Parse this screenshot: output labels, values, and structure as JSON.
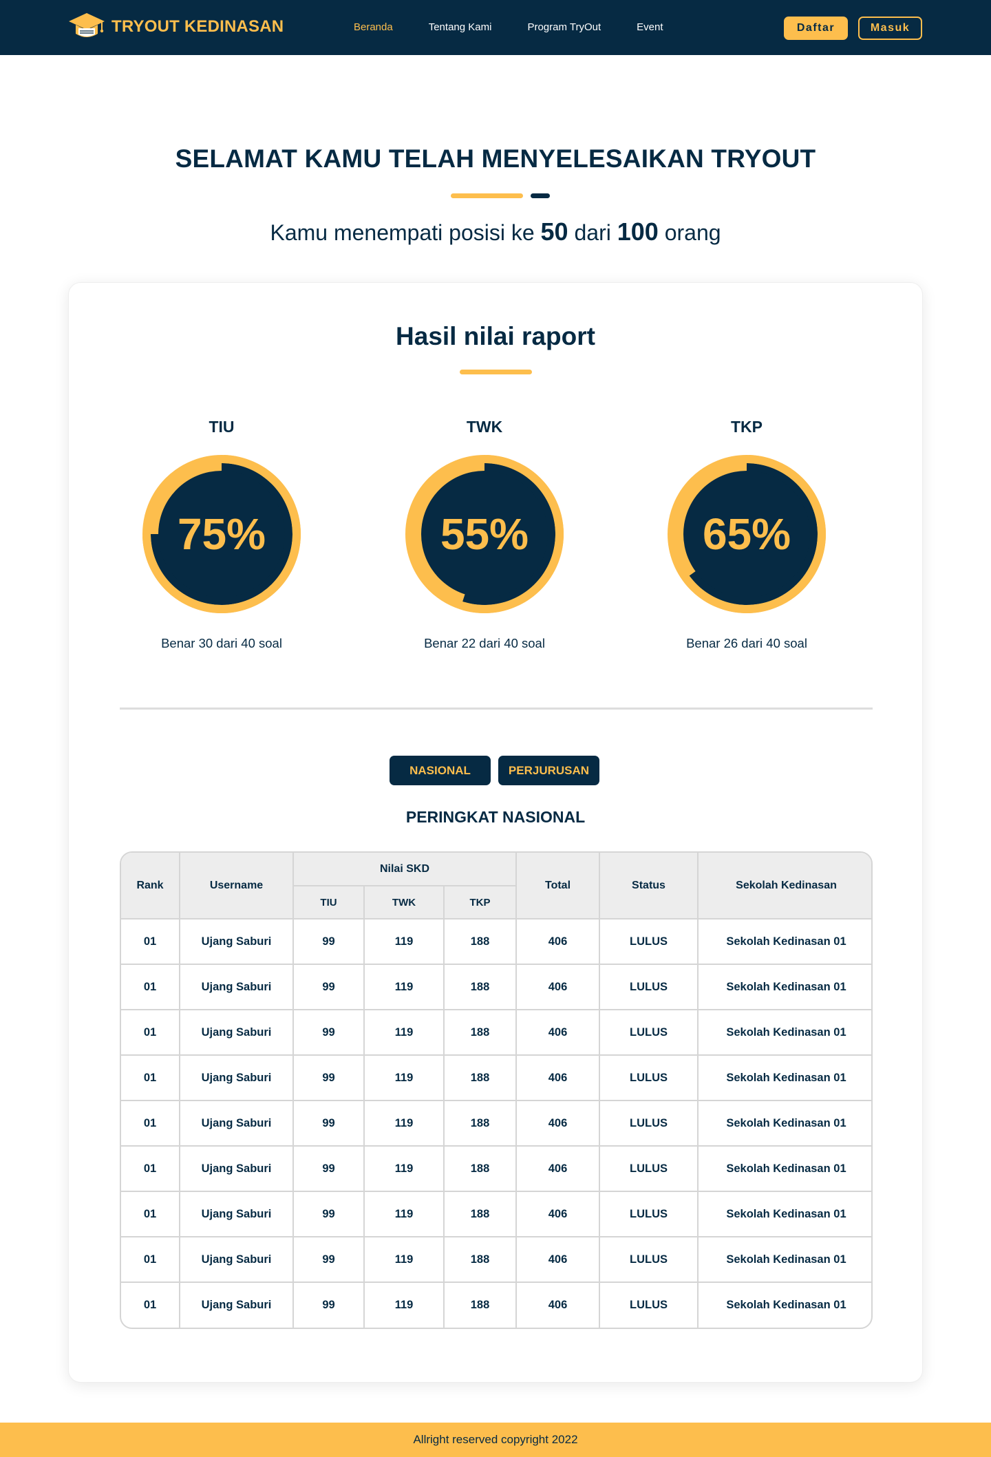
{
  "nav": {
    "brand": "TRYOUT KEDINASAN",
    "logo_icon": "graduation-cap-icon",
    "links": [
      {
        "label": "Beranda",
        "active": true
      },
      {
        "label": "Tentang Kami",
        "active": false
      },
      {
        "label": "Program TryOut",
        "active": false
      },
      {
        "label": "Event",
        "active": false
      }
    ],
    "register_label": "Daftar",
    "login_label": "Masuk"
  },
  "hero": {
    "title": "SELAMAT KAMU TELAH MENYELESAIKAN TRYOUT",
    "position_prefix": "Kamu menempati posisi ke",
    "position_value": "50",
    "position_middle": "dari",
    "total_value": "100",
    "position_suffix": "orang"
  },
  "report": {
    "title": "Hasil nilai raport",
    "scores": [
      {
        "label": "TIU",
        "percent": 75,
        "percent_text": "75%",
        "caption": "Benar 30 dari 40 soal"
      },
      {
        "label": "TWK",
        "percent": 55,
        "percent_text": "55%",
        "caption": "Benar 22 dari 40 soal"
      },
      {
        "label": "TKP",
        "percent": 65,
        "percent_text": "65%",
        "caption": "Benar 26 dari 40 soal"
      }
    ]
  },
  "ranking": {
    "tabs": [
      "NASIONAL",
      "PERJURUSAN"
    ],
    "title": "PERINGKAT NASIONAL",
    "headers": {
      "rank": "Rank",
      "username": "Username",
      "skd": "Nilai SKD",
      "tiu": "TIU",
      "twk": "TWK",
      "tkp": "TKP",
      "total": "Total",
      "status": "Status",
      "school": "Sekolah Kedinasan"
    },
    "rows": [
      {
        "rank": "01",
        "username": "Ujang Saburi",
        "tiu": "99",
        "twk": "119",
        "tkp": "188",
        "total": "406",
        "status": "LULUS",
        "school": "Sekolah Kedinasan 01"
      },
      {
        "rank": "01",
        "username": "Ujang Saburi",
        "tiu": "99",
        "twk": "119",
        "tkp": "188",
        "total": "406",
        "status": "LULUS",
        "school": "Sekolah Kedinasan 01"
      },
      {
        "rank": "01",
        "username": "Ujang Saburi",
        "tiu": "99",
        "twk": "119",
        "tkp": "188",
        "total": "406",
        "status": "LULUS",
        "school": "Sekolah Kedinasan 01"
      },
      {
        "rank": "01",
        "username": "Ujang Saburi",
        "tiu": "99",
        "twk": "119",
        "tkp": "188",
        "total": "406",
        "status": "LULUS",
        "school": "Sekolah Kedinasan 01"
      },
      {
        "rank": "01",
        "username": "Ujang Saburi",
        "tiu": "99",
        "twk": "119",
        "tkp": "188",
        "total": "406",
        "status": "LULUS",
        "school": "Sekolah Kedinasan 01"
      },
      {
        "rank": "01",
        "username": "Ujang Saburi",
        "tiu": "99",
        "twk": "119",
        "tkp": "188",
        "total": "406",
        "status": "LULUS",
        "school": "Sekolah Kedinasan 01"
      },
      {
        "rank": "01",
        "username": "Ujang Saburi",
        "tiu": "99",
        "twk": "119",
        "tkp": "188",
        "total": "406",
        "status": "LULUS",
        "school": "Sekolah Kedinasan 01"
      },
      {
        "rank": "01",
        "username": "Ujang Saburi",
        "tiu": "99",
        "twk": "119",
        "tkp": "188",
        "total": "406",
        "status": "LULUS",
        "school": "Sekolah Kedinasan 01"
      },
      {
        "rank": "01",
        "username": "Ujang Saburi",
        "tiu": "99",
        "twk": "119",
        "tkp": "188",
        "total": "406",
        "status": "LULUS",
        "school": "Sekolah Kedinasan 01"
      }
    ]
  },
  "footer": {
    "text": "Allright reserved copyright 2022"
  },
  "colors": {
    "navy": "#062A43",
    "accent": "#FDBE4D",
    "border": "#D5D5D5",
    "header_bg": "#EDEDED"
  }
}
